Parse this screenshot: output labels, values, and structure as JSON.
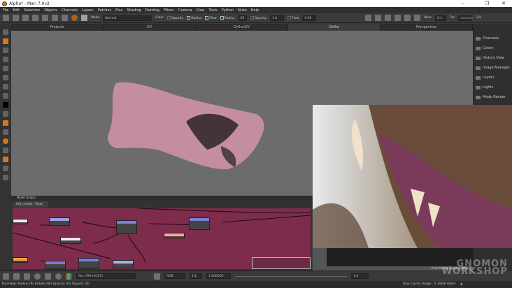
{
  "window": {
    "title": "Alpha* - Mari 7.0v2",
    "minimize": "–",
    "restore": "❐",
    "close": "✕"
  },
  "menu": [
    "File",
    "Edit",
    "Selection",
    "Objects",
    "Channels",
    "Layers",
    "Patches",
    "Plex",
    "Shading",
    "Painting",
    "Filters",
    "Camera",
    "View",
    "Tools",
    "Python",
    "Nuke",
    "Help"
  ],
  "toolbar": {
    "mode_label": "Mode",
    "mode_value": "Normal",
    "color_label": "Color",
    "opacity_label": "Opacity",
    "radius_label": "Radius",
    "flow_label": "Flow",
    "radius2_label": "Radius",
    "radius2_value": "85",
    "opacity2_label": "Opacity",
    "opacity2_value": "1.0",
    "flow2_label": "Flow",
    "flow2_value": "0.96",
    "near_label": "Near",
    "near_value": "0.1",
    "far_label": "Far",
    "far_value": "1,000,000",
    "fov_label": "FoV"
  },
  "tabs": [
    "Projects",
    "UV",
    "Ortho/UV",
    "Ortho",
    "Perspective"
  ],
  "active_tab": "Ortho",
  "right_panel": [
    "Channels",
    "Colors",
    "History View",
    "Image Manager",
    "Layers",
    "Lights",
    "Modo Render"
  ],
  "node_graph": {
    "title": "Node Graph",
    "tab": "full_model - Root"
  },
  "paint_buffer": "Paint Buffer Zoom (100%)",
  "bottom": {
    "colorspace": "Rec.709 (ACES)",
    "channel": "RGB",
    "frame": "1/1",
    "gain": "1.000000",
    "value": "1.0"
  },
  "status": {
    "tool_help": "Tool Help:  Radius (R)   Rotate (W)   Opacity (O)   Squash (Q)",
    "disk_cache": "Disk Cache Usage : 5.38GB  Udim:"
  },
  "watermark": "GNOMON WORKSHOP"
}
